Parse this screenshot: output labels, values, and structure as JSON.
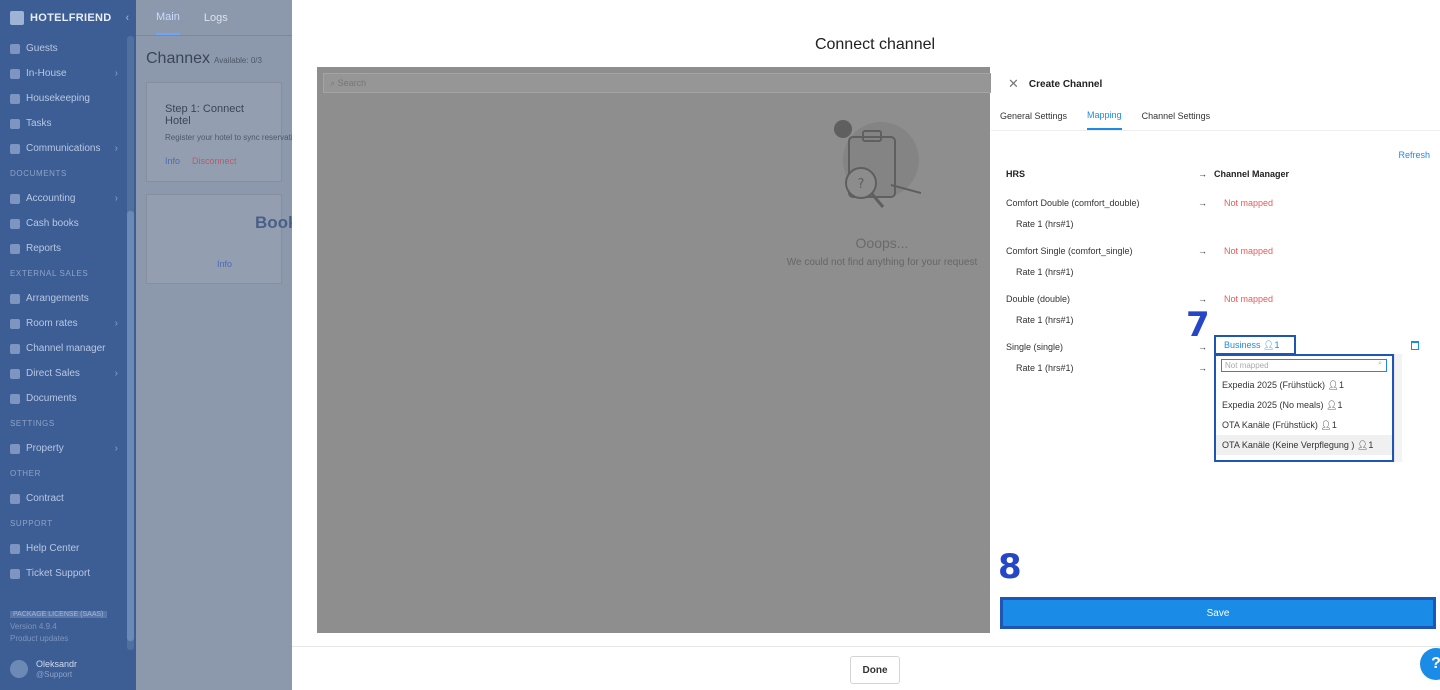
{
  "sidebar": {
    "brand": "HOTELFRIEND",
    "items": {
      "guests": "Guests",
      "inhouse": "In-House",
      "housekeeping": "Housekeeping",
      "tasks": "Tasks",
      "communications": "Communications",
      "accounting": "Accounting",
      "cashbooks": "Cash books",
      "reports": "Reports",
      "arrangements": "Arrangements",
      "roomrates": "Room rates",
      "channelmanager": "Channel manager",
      "directsales": "Direct Sales",
      "documents": "Documents",
      "property": "Property",
      "contract": "Contract",
      "helpcenter": "Help Center",
      "ticketsupport": "Ticket Support"
    },
    "sections": {
      "documents": "DOCUMENTS",
      "external_sales": "EXTERNAL SALES",
      "settings": "SETTINGS",
      "other": "OTHER",
      "support": "SUPPORT"
    },
    "footer": {
      "license": "PACKAGE LICENSE (SAAS)",
      "version": "Version 4.9.4",
      "updates": "Product updates"
    },
    "user": {
      "name": "Oleksandr",
      "role": "@Support"
    }
  },
  "page": {
    "tabs": [
      "Main",
      "Logs"
    ],
    "title": "Channex",
    "available": "Available: 0/3",
    "step_title": "Step 1: Connect Hotel",
    "step_desc": "Register your hotel to sync reservations",
    "info": "Info",
    "disconnect": "Disconnect",
    "card2_title": "Book",
    "card2_info": "Info"
  },
  "modal": {
    "title": "Connect channel",
    "search_placeholder": "Search",
    "empty_title": "Ooops...",
    "empty_sub": "We could not find anything for your request",
    "done": "Done"
  },
  "drawer": {
    "title": "Create Channel",
    "tabs": [
      "General Settings",
      "Mapping",
      "Channel Settings"
    ],
    "refresh": "Refresh",
    "col_hrs": "HRS",
    "col_cm": "Channel Manager",
    "arrow": "→",
    "rows": [
      {
        "room": "Comfort Double (comfort_double)",
        "status": "Not mapped",
        "rate": "Rate 1 (hrs#1)"
      },
      {
        "room": "Comfort Single (comfort_single)",
        "status": "Not mapped",
        "rate": "Rate 1 (hrs#1)"
      },
      {
        "room": "Double (double)",
        "status": "Not mapped",
        "rate": "Rate 1 (hrs#1)"
      },
      {
        "room": "Single (single)",
        "status": "",
        "rate": "Rate 1 (hrs#1)"
      }
    ],
    "selected": "Business",
    "selected_count": "1",
    "dropdown_placeholder": "Not mapped",
    "options": [
      {
        "label": "Expedia 2025 (Frühstück)",
        "count": "1"
      },
      {
        "label": "Expedia 2025 (No meals)",
        "count": "1"
      },
      {
        "label": "OTA Kanäle (Frühstück)",
        "count": "1"
      },
      {
        "label": "OTA Kanäle (Keine Verpflegung )",
        "count": "1"
      }
    ],
    "step7": "7",
    "step8": "8",
    "save": "Save"
  },
  "help": "?",
  "colors": {
    "primary": "#1a8ce8",
    "annotation": "#1f56b5",
    "sidebar": "#3d5e95",
    "error": "#e85a5a"
  }
}
